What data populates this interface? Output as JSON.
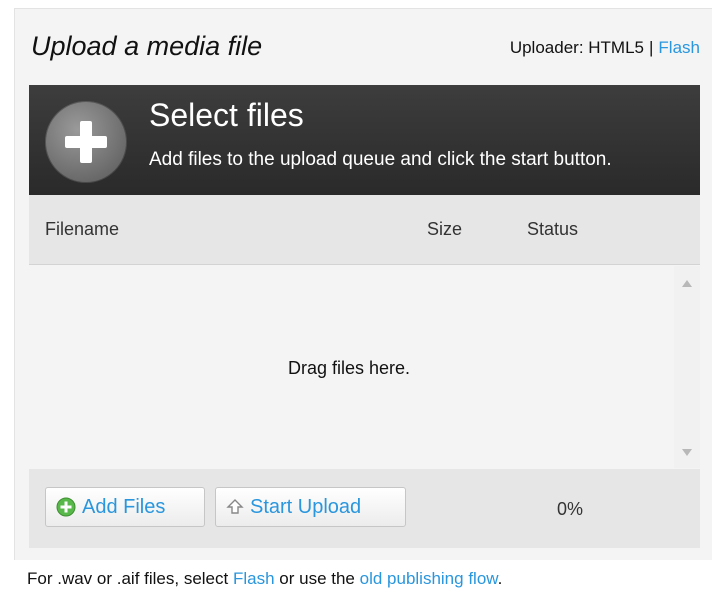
{
  "header": {
    "title": "Upload a media file",
    "uploader_label": "Uploader: HTML5",
    "separator": "|",
    "flash_link": "Flash"
  },
  "select_files": {
    "icon": "plus-icon",
    "title": "Select files",
    "description": "Add files to the upload queue and click the start button."
  },
  "file_table": {
    "columns": [
      "Filename",
      "Size",
      "Status"
    ],
    "rows": [],
    "empty_text": "Drag files here."
  },
  "actions": {
    "add_files_label": "Add Files",
    "add_files_icon": "add-circle-icon",
    "start_upload_label": "Start Upload",
    "start_upload_icon": "upload-arrow-icon",
    "progress_text": "0%",
    "progress": 0
  },
  "note": {
    "prefix": "For .wav or .aif files, select",
    "flash_link": "Flash",
    "middle": "or use the",
    "old_flow_link": "old publishing flow",
    "suffix": "."
  },
  "colors": {
    "link": "#2996dd",
    "add_icon": "#59b84a",
    "select_bar": "#333333"
  }
}
